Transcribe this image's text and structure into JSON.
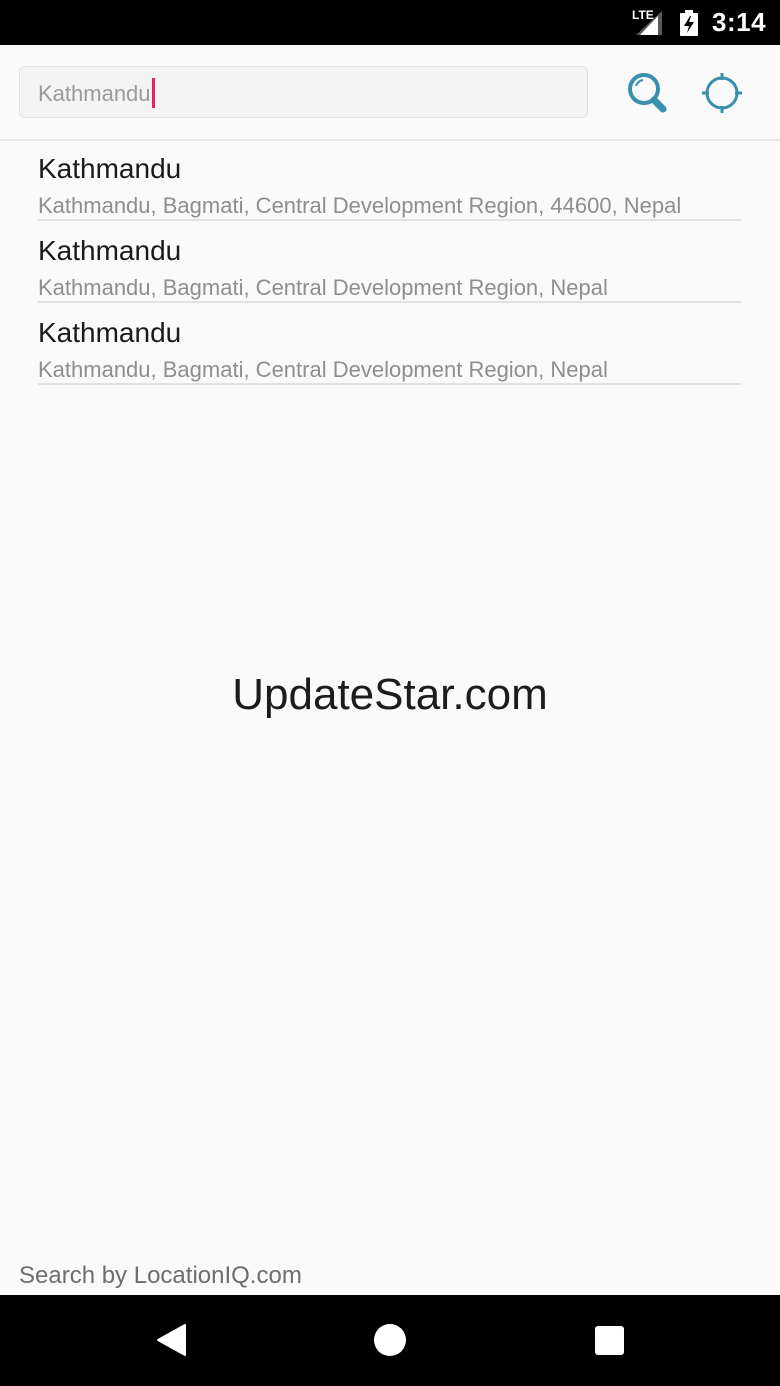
{
  "status_bar": {
    "network": "LTE",
    "time": "3:14"
  },
  "search": {
    "value": "Kathmandu",
    "icons": [
      "search-icon",
      "crosshair-locate-icon"
    ]
  },
  "results": [
    {
      "title": "Kathmandu",
      "subtitle": "Kathmandu, Bagmati, Central Development Region, 44600, Nepal"
    },
    {
      "title": "Kathmandu",
      "subtitle": "Kathmandu, Bagmati, Central Development Region, Nepal"
    },
    {
      "title": "Kathmandu",
      "subtitle": "Kathmandu, Bagmati, Central Development Region, Nepal"
    }
  ],
  "watermark": "UpdateStar.com",
  "footer": "Search by LocationIQ.com",
  "nav_bar": {
    "icons": [
      "back-icon",
      "home-icon",
      "recents-icon"
    ]
  },
  "colors": {
    "accent": "#3a8fae",
    "caret": "#e0245e",
    "background": "#fafafa"
  }
}
